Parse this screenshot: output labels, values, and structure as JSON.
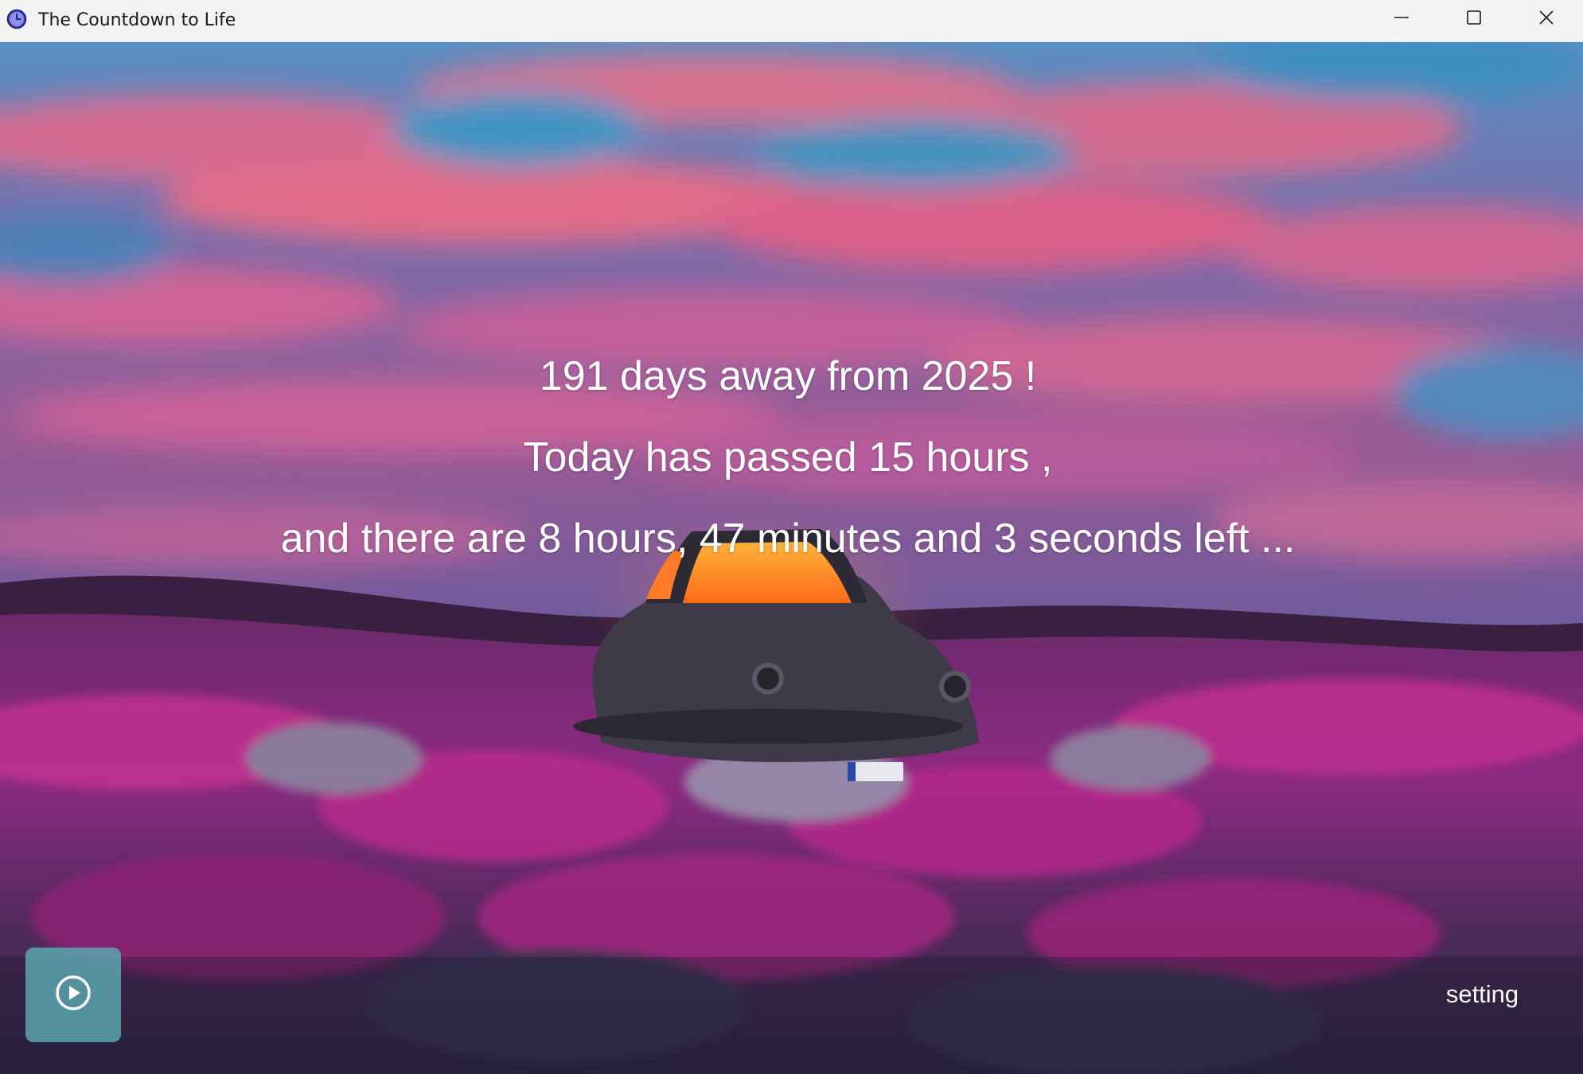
{
  "window": {
    "title": "The Countdown to Life",
    "icons": {
      "app": "clock-icon",
      "minimize": "minimize-icon",
      "maximize": "maximize-icon",
      "close": "close-icon"
    }
  },
  "countdown": {
    "line1": "191 days away from 2025 !",
    "line2": "Today has passed 15 hours ,",
    "line3": "and there are 8 hours, 47 minutes and 3 seconds left ..."
  },
  "controls": {
    "play_icon": "play-circle-icon",
    "setting_label": "setting"
  },
  "colors": {
    "play_button_bg": "#5caab2",
    "text": "#ffffff",
    "sky_pink": "#e2607f",
    "sky_blue": "#3f8db8",
    "heather": "#b0268f"
  }
}
